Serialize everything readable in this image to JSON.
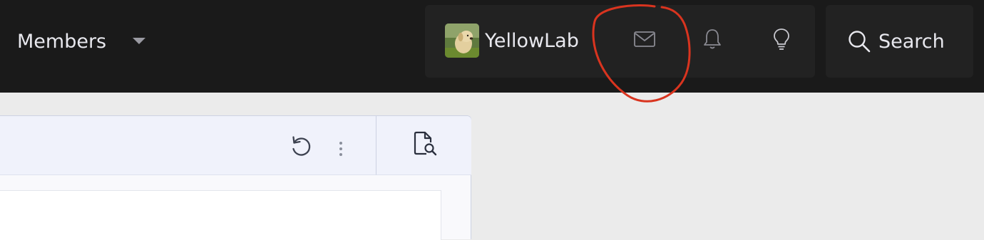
{
  "nav": {
    "members_label": "Members",
    "members_caret_icon": "chevron-down-icon",
    "user": {
      "name": "YellowLab",
      "avatar_description": "yellow-labrador-avatar"
    },
    "icons": [
      "envelope-icon",
      "bell-icon",
      "lightbulb-icon"
    ],
    "search_label": "Search",
    "search_icon": "search-icon"
  },
  "editor": {
    "toolbar_icons": [
      "undo-icon",
      "more-vertical-icon"
    ],
    "preview_icon": "document-search-icon"
  },
  "colors": {
    "topbar": "#1a1a1a",
    "topbar_group": "#222222",
    "annotation": "#d9341f",
    "editor_toolbar": "#f0f2fb"
  }
}
